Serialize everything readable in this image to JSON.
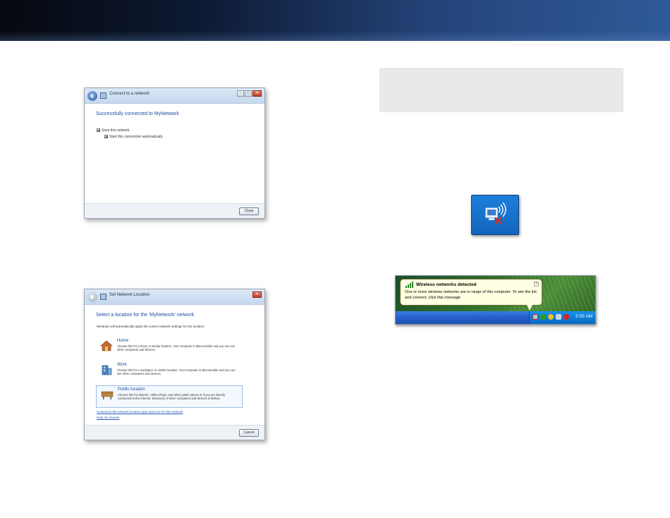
{
  "windows": {
    "connect": {
      "title": "Connect to a network",
      "heading": "Successfully connected to MyNetwork",
      "save_network_label": "Save this network",
      "start_auto_label": "Start this connection automatically",
      "close_button": "Close"
    },
    "location": {
      "title": "Set Network Location",
      "heading": "Select a location for the 'MyNetwork' network",
      "intro": "Windows will automatically apply the correct network settings for the location.",
      "options": [
        {
          "title": "Home",
          "desc": "Choose this for a home or similar location. Your computer is discoverable and you can see other computers and devices."
        },
        {
          "title": "Work",
          "desc": "Choose this for a workplace or similar location. Your computer is discoverable and you can see other computers and devices."
        },
        {
          "title": "Public location",
          "desc": "Choose this for airports, coffee shops, and other public places or if you are directly connected to the Internet. Discovery of other computers and devices is limited."
        }
      ],
      "link_customize": "Customize the network location type and icon for this network",
      "link_help": "Help me choose",
      "cancel_button": "Cancel"
    }
  },
  "tray_popup": {
    "title": "Wireless networks detected",
    "message": "One or more wireless networks are in range of this computer. To see the list and connect, click this message",
    "close_glyph": "x",
    "time": "5:55 AM"
  },
  "icons": {
    "network_tile": "wireless-network-disconnected-icon",
    "balloon_icon": "wireless-signal-icon"
  },
  "colors": {
    "header_dark": "#05080f",
    "header_light": "#2f5a98",
    "heading_blue": "#1b4d9c",
    "tile_blue": "#1e7fd9"
  }
}
